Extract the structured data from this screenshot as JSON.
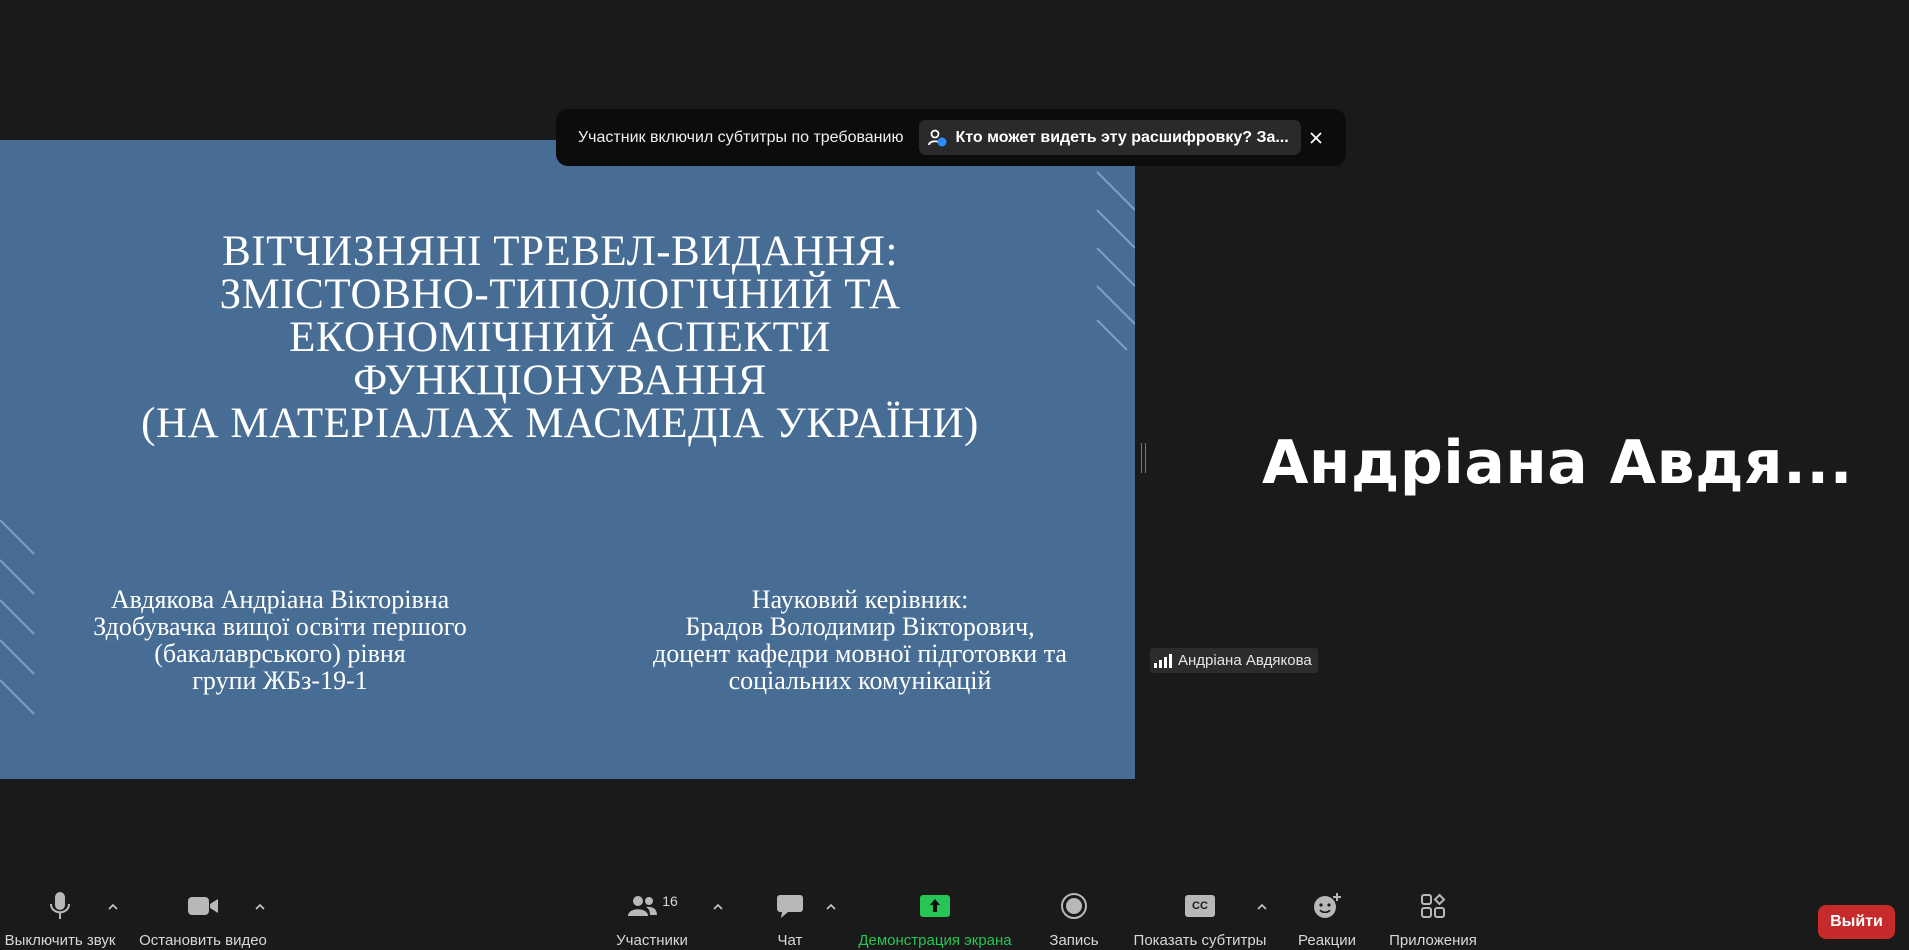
{
  "banner": {
    "text": "Участник включил субтитры по требованию",
    "link_label": "Кто может видеть эту расшифровку? За..."
  },
  "slide": {
    "title_lines": [
      "ВІТЧИЗНЯНІ ТРЕВЕЛ-ВИДАННЯ:",
      "ЗМІСТОВНО-ТИПОЛОГІЧНИЙ ТА",
      "ЕКОНОМІЧНИЙ АСПЕКТИ",
      "ФУНКЦІОНУВАННЯ",
      "(НА МАТЕРІАЛАХ МАСМЕДІА УКРАЇНИ)"
    ],
    "author_lines": [
      "Авдякова Андріана Вікторівна",
      "Здобувачка вищої освіти першого",
      "(бакалаврського) рівня",
      "групи ЖБз-19-1"
    ],
    "advisor_lines": [
      "Науковий керівник:",
      "Брадов Володимир Вікторович,",
      "доцент кафедри мовної підготовки та",
      "соціальних комунікацій"
    ],
    "background_color": "#476d94"
  },
  "participant": {
    "display_name": "Андріана Авдя...",
    "name_tag": "Андріана Авдякова"
  },
  "toolbar": {
    "mute_label": "Выключить звук",
    "video_label": "Остановить видео",
    "participants_label": "Участники",
    "participants_count": "16",
    "chat_label": "Чат",
    "share_label": "Демонстрация экрана",
    "record_label": "Запись",
    "captions_label": "Показать субтитры",
    "captions_icon_text": "CC",
    "reactions_label": "Реакции",
    "apps_label": "Приложения",
    "leave_label": "Выйти"
  },
  "colors": {
    "background": "#1a1a1a",
    "share_green": "#27c456",
    "leave_red": "#c72a2a"
  }
}
